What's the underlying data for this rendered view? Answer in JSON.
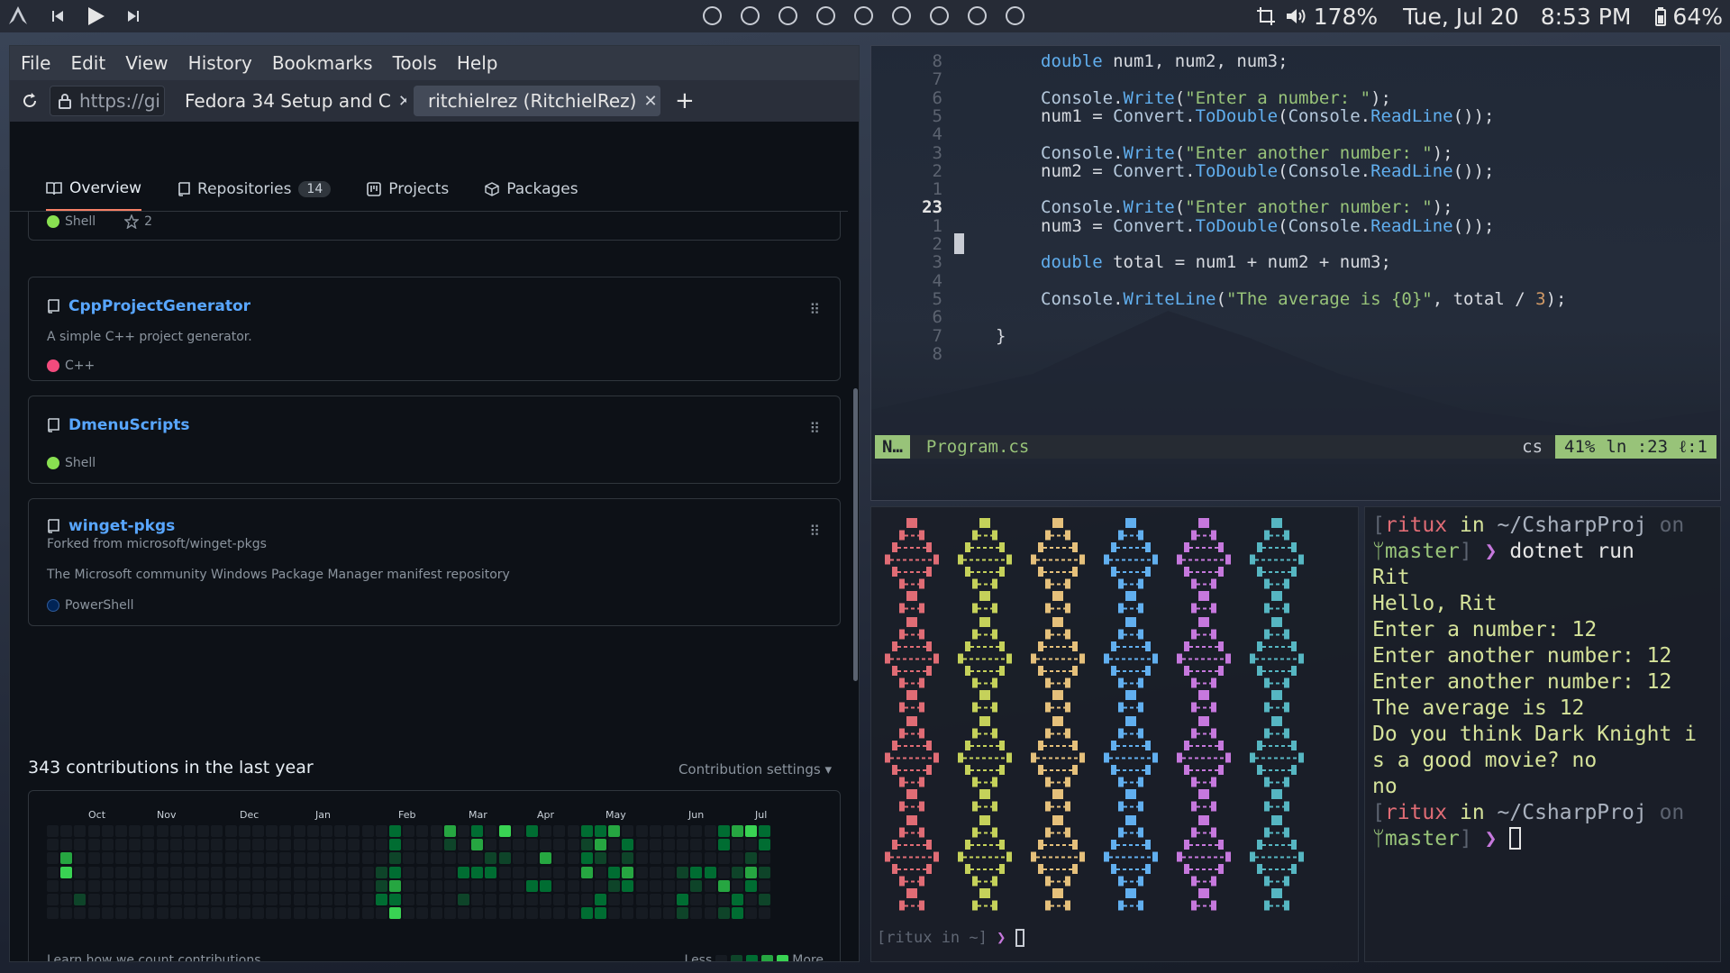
{
  "topbar": {
    "zoom": "178%",
    "date": "Tue, Jul 20",
    "time": "8:53 PM",
    "battery": "64%",
    "workspaces": 9
  },
  "browser": {
    "menu": [
      "File",
      "Edit",
      "View",
      "History",
      "Bookmarks",
      "Tools",
      "Help"
    ],
    "url": "https://gi",
    "tabs": [
      {
        "label": "Fedora 34 Setup and C",
        "active": false
      },
      {
        "label": "ritchielrez (RitchielRez)",
        "active": true
      }
    ],
    "gh_nav": {
      "overview": "Overview",
      "repositories": "Repositories",
      "repo_count": "14",
      "projects": "Projects",
      "packages": "Packages"
    },
    "top_card": {
      "lang": "Shell",
      "stars": "2"
    },
    "repos": [
      {
        "name": "CppProjectGenerator",
        "desc": "A simple C++ project generator.",
        "lang": "C++",
        "color": "#f34b7d",
        "fork": ""
      },
      {
        "name": "DmenuScripts",
        "desc": "",
        "lang": "Shell",
        "color": "#89e051",
        "fork": ""
      },
      {
        "name": "winget-pkgs",
        "fork": "Forked from microsoft/winget-pkgs",
        "desc": "The Microsoft community Windows Package Manager manifest repository",
        "lang": "PowerShell",
        "color": "#012456"
      }
    ],
    "contrib": {
      "heading": "343 contributions in the last year",
      "settings": "Contribution settings",
      "months": [
        "Oct",
        "Nov",
        "Dec",
        "Jan",
        "Feb",
        "Mar",
        "Apr",
        "May",
        "Jun",
        "Jul"
      ],
      "footer": "Learn how we count contributions",
      "less": "Less",
      "more": "More",
      "colors": [
        "#161b22",
        "#0e4429",
        "#006d32",
        "#26a641",
        "#39d353"
      ]
    }
  },
  "editor": {
    "lines": [
      {
        "n": "8",
        "code": "double num1, num2, num3;"
      },
      {
        "n": "7",
        "code": ""
      },
      {
        "n": "6",
        "code": "Console.Write(\"Enter a number: \");"
      },
      {
        "n": "5",
        "code": "num1 = Convert.ToDouble(Console.ReadLine());"
      },
      {
        "n": "4",
        "code": ""
      },
      {
        "n": "3",
        "code": "Console.Write(\"Enter another number: \");"
      },
      {
        "n": "2",
        "code": "num2 = Convert.ToDouble(Console.ReadLine());"
      },
      {
        "n": "1",
        "code": ""
      },
      {
        "n": "23",
        "code": "Console.Write(\"Enter another number: \");"
      },
      {
        "n": "1",
        "code": "num3 = Convert.ToDouble(Console.ReadLine());"
      },
      {
        "n": "2",
        "code": ""
      },
      {
        "n": "3",
        "code": "double total = num1 + num2 + num3;"
      },
      {
        "n": "4",
        "code": ""
      },
      {
        "n": "5",
        "code": "Console.WriteLine(\"The average is {0}\", total / 3);"
      },
      {
        "n": "6",
        "code": ""
      },
      {
        "n": "7",
        "code": "}"
      },
      {
        "n": "8",
        "code": ""
      }
    ],
    "status": {
      "mode": "N…",
      "file": "Program.cs",
      "filetype": "cs",
      "percent": "41%",
      "line": "ln :23",
      "col": "ℓ:1"
    }
  },
  "pipes": {
    "prompt_user": "ritux",
    "prompt_in": "in",
    "prompt_dir": "~",
    "colors": [
      "#e06c75",
      "#c5d15a",
      "#e5c07b",
      "#61afef",
      "#c678dd",
      "#56b6c2"
    ]
  },
  "terminal": {
    "user": "ritux",
    "in": "in",
    "dir": "~/CsharpProj",
    "on": "on",
    "branch": "master",
    "command": "dotnet run",
    "output": [
      "Rit",
      "Hello, Rit",
      "Enter a number: 12",
      "Enter another number: 12",
      "Enter another number: 12",
      "The average is 12",
      "Do you think Dark Knight i",
      "s a good movie? no",
      "no"
    ]
  }
}
